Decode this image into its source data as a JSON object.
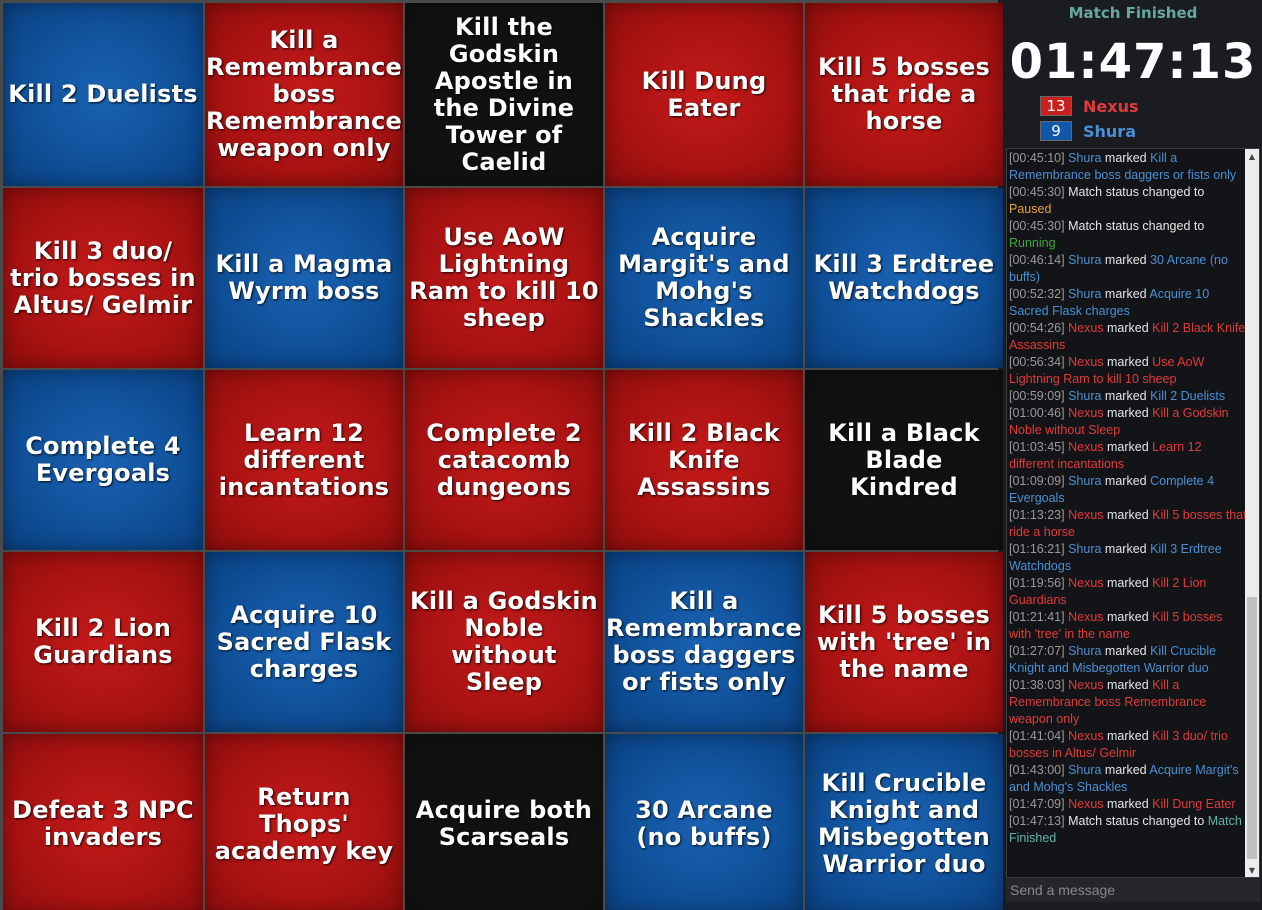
{
  "board": {
    "cells": [
      {
        "text": "Kill 2 Duelists",
        "color": "blue"
      },
      {
        "text": "Kill a Remembrance boss Remembrance weapon only",
        "color": "red"
      },
      {
        "text": "Kill the Godskin Apostle in the Divine Tower of Caelid",
        "color": "black"
      },
      {
        "text": "Kill Dung Eater",
        "color": "red"
      },
      {
        "text": "Kill 5 bosses that ride a horse",
        "color": "red"
      },
      {
        "text": "Kill 3 duo/ trio bosses in Altus/ Gelmir",
        "color": "red"
      },
      {
        "text": "Kill a Magma Wyrm boss",
        "color": "blue"
      },
      {
        "text": "Use AoW Lightning Ram to kill 10 sheep",
        "color": "red"
      },
      {
        "text": "Acquire Margit's and Mohg's Shackles",
        "color": "blue"
      },
      {
        "text": "Kill 3 Erdtree Watchdogs",
        "color": "blue"
      },
      {
        "text": "Complete 4 Evergoals",
        "color": "blue"
      },
      {
        "text": "Learn 12 different incantations",
        "color": "red"
      },
      {
        "text": "Complete 2 catacomb dungeons",
        "color": "red"
      },
      {
        "text": "Kill 2 Black Knife Assassins",
        "color": "red"
      },
      {
        "text": "Kill a Black Blade Kindred",
        "color": "black"
      },
      {
        "text": "Kill 2 Lion Guardians",
        "color": "red"
      },
      {
        "text": "Acquire 10 Sacred Flask charges",
        "color": "blue"
      },
      {
        "text": "Kill a Godskin Noble without Sleep",
        "color": "red"
      },
      {
        "text": "Kill a Remembrance boss daggers or fists only",
        "color": "blue"
      },
      {
        "text": "Kill 5 bosses with 'tree' in the name",
        "color": "red"
      },
      {
        "text": "Defeat 3 NPC invaders",
        "color": "red"
      },
      {
        "text": "Return Thops' academy key",
        "color": "red"
      },
      {
        "text": "Acquire both Scarseals",
        "color": "black"
      },
      {
        "text": "30 Arcane (no buffs)",
        "color": "blue"
      },
      {
        "text": "Kill Crucible Knight and Misbegotten Warrior duo",
        "color": "blue"
      }
    ]
  },
  "sidebar": {
    "status": "Match Finished",
    "timer": "01:47:13",
    "players": [
      {
        "score": "13",
        "name": "Nexus",
        "color": "#e23a3a",
        "badge": "#c81f1f"
      },
      {
        "score": "9",
        "name": "Shura",
        "color": "#4a90d6",
        "badge": "#0f57a8"
      }
    ]
  },
  "chat": {
    "lines": [
      {
        "time": "[00:45:10]",
        "parts": [
          {
            "t": "Shura",
            "c": "sh"
          },
          {
            "t": " marked ",
            "c": "tx"
          },
          {
            "t": "Kill a Remembrance boss daggers or fists only",
            "c": "sh"
          }
        ]
      },
      {
        "time": "[00:45:30]",
        "parts": [
          {
            "t": "Match status changed to ",
            "c": "tx"
          },
          {
            "t": "Paused",
            "c": "og"
          }
        ]
      },
      {
        "time": "[00:45:30]",
        "parts": [
          {
            "t": "Match status changed to ",
            "c": "tx"
          },
          {
            "t": "Running",
            "c": "gr"
          }
        ]
      },
      {
        "time": "[00:46:14]",
        "parts": [
          {
            "t": "Shura",
            "c": "sh"
          },
          {
            "t": " marked ",
            "c": "tx"
          },
          {
            "t": "30 Arcane (no buffs)",
            "c": "sh"
          }
        ]
      },
      {
        "time": "[00:52:32]",
        "parts": [
          {
            "t": "Shura",
            "c": "sh"
          },
          {
            "t": " marked ",
            "c": "tx"
          },
          {
            "t": "Acquire 10 Sacred Flask charges",
            "c": "sh"
          }
        ]
      },
      {
        "time": "[00:54:26]",
        "parts": [
          {
            "t": "Nexus",
            "c": "nx"
          },
          {
            "t": " marked ",
            "c": "tx"
          },
          {
            "t": "Kill 2 Black Knife Assassins",
            "c": "nx"
          }
        ]
      },
      {
        "time": "[00:56:34]",
        "parts": [
          {
            "t": "Nexus",
            "c": "nx"
          },
          {
            "t": " marked ",
            "c": "tx"
          },
          {
            "t": "Use AoW Lightning Ram to kill 10 sheep",
            "c": "nx"
          }
        ]
      },
      {
        "time": "[00:59:09]",
        "parts": [
          {
            "t": "Shura",
            "c": "sh"
          },
          {
            "t": " marked ",
            "c": "tx"
          },
          {
            "t": "Kill 2 Duelists",
            "c": "sh"
          }
        ]
      },
      {
        "time": "[01:00:46]",
        "parts": [
          {
            "t": "Nexus",
            "c": "nx"
          },
          {
            "t": " marked ",
            "c": "tx"
          },
          {
            "t": "Kill a Godskin Noble without Sleep",
            "c": "nx"
          }
        ]
      },
      {
        "time": "[01:03:45]",
        "parts": [
          {
            "t": "Nexus",
            "c": "nx"
          },
          {
            "t": " marked ",
            "c": "tx"
          },
          {
            "t": "Learn 12 different incantations",
            "c": "nx"
          }
        ]
      },
      {
        "time": "[01:09:09]",
        "parts": [
          {
            "t": "Shura",
            "c": "sh"
          },
          {
            "t": " marked ",
            "c": "tx"
          },
          {
            "t": "Complete 4 Evergoals",
            "c": "sh"
          }
        ]
      },
      {
        "time": "[01:13:23]",
        "parts": [
          {
            "t": "Nexus",
            "c": "nx"
          },
          {
            "t": " marked ",
            "c": "tx"
          },
          {
            "t": "Kill 5 bosses that ride a horse",
            "c": "nx"
          }
        ]
      },
      {
        "time": "[01:16:21]",
        "parts": [
          {
            "t": "Shura",
            "c": "sh"
          },
          {
            "t": " marked ",
            "c": "tx"
          },
          {
            "t": "Kill 3 Erdtree Watchdogs",
            "c": "sh"
          }
        ]
      },
      {
        "time": "[01:19:56]",
        "parts": [
          {
            "t": "Nexus",
            "c": "nx"
          },
          {
            "t": " marked ",
            "c": "tx"
          },
          {
            "t": "Kill 2 Lion Guardians",
            "c": "nx"
          }
        ]
      },
      {
        "time": "[01:21:41]",
        "parts": [
          {
            "t": "Nexus",
            "c": "nx"
          },
          {
            "t": " marked ",
            "c": "tx"
          },
          {
            "t": "Kill 5 bosses with 'tree' in the name",
            "c": "nx"
          }
        ]
      },
      {
        "time": "[01:27:07]",
        "parts": [
          {
            "t": "Shura",
            "c": "sh"
          },
          {
            "t": " marked ",
            "c": "tx"
          },
          {
            "t": "Kill Crucible Knight and Misbegotten Warrior duo",
            "c": "sh"
          }
        ]
      },
      {
        "time": "[01:38:03]",
        "parts": [
          {
            "t": "Nexus",
            "c": "nx"
          },
          {
            "t": " marked ",
            "c": "tx"
          },
          {
            "t": "Kill a Remembrance boss Remembrance weapon only",
            "c": "nx"
          }
        ]
      },
      {
        "time": "[01:41:04]",
        "parts": [
          {
            "t": "Nexus",
            "c": "nx"
          },
          {
            "t": " marked ",
            "c": "tx"
          },
          {
            "t": "Kill 3 duo/ trio bosses in Altus/ Gelmir",
            "c": "nx"
          }
        ]
      },
      {
        "time": "[01:43:00]",
        "parts": [
          {
            "t": "Shura",
            "c": "sh"
          },
          {
            "t": " marked ",
            "c": "tx"
          },
          {
            "t": "Acquire Margit's and Mohg's Shackles",
            "c": "sh"
          }
        ]
      },
      {
        "time": "[01:47:09]",
        "parts": [
          {
            "t": "Nexus",
            "c": "nx"
          },
          {
            "t": " marked ",
            "c": "tx"
          },
          {
            "t": "Kill Dung Eater",
            "c": "nx"
          }
        ]
      },
      {
        "time": "[01:47:13]",
        "parts": [
          {
            "t": "Match status changed to ",
            "c": "tx"
          },
          {
            "t": "Match Finished",
            "c": "tl"
          }
        ]
      }
    ],
    "input_placeholder": "Send a message"
  }
}
